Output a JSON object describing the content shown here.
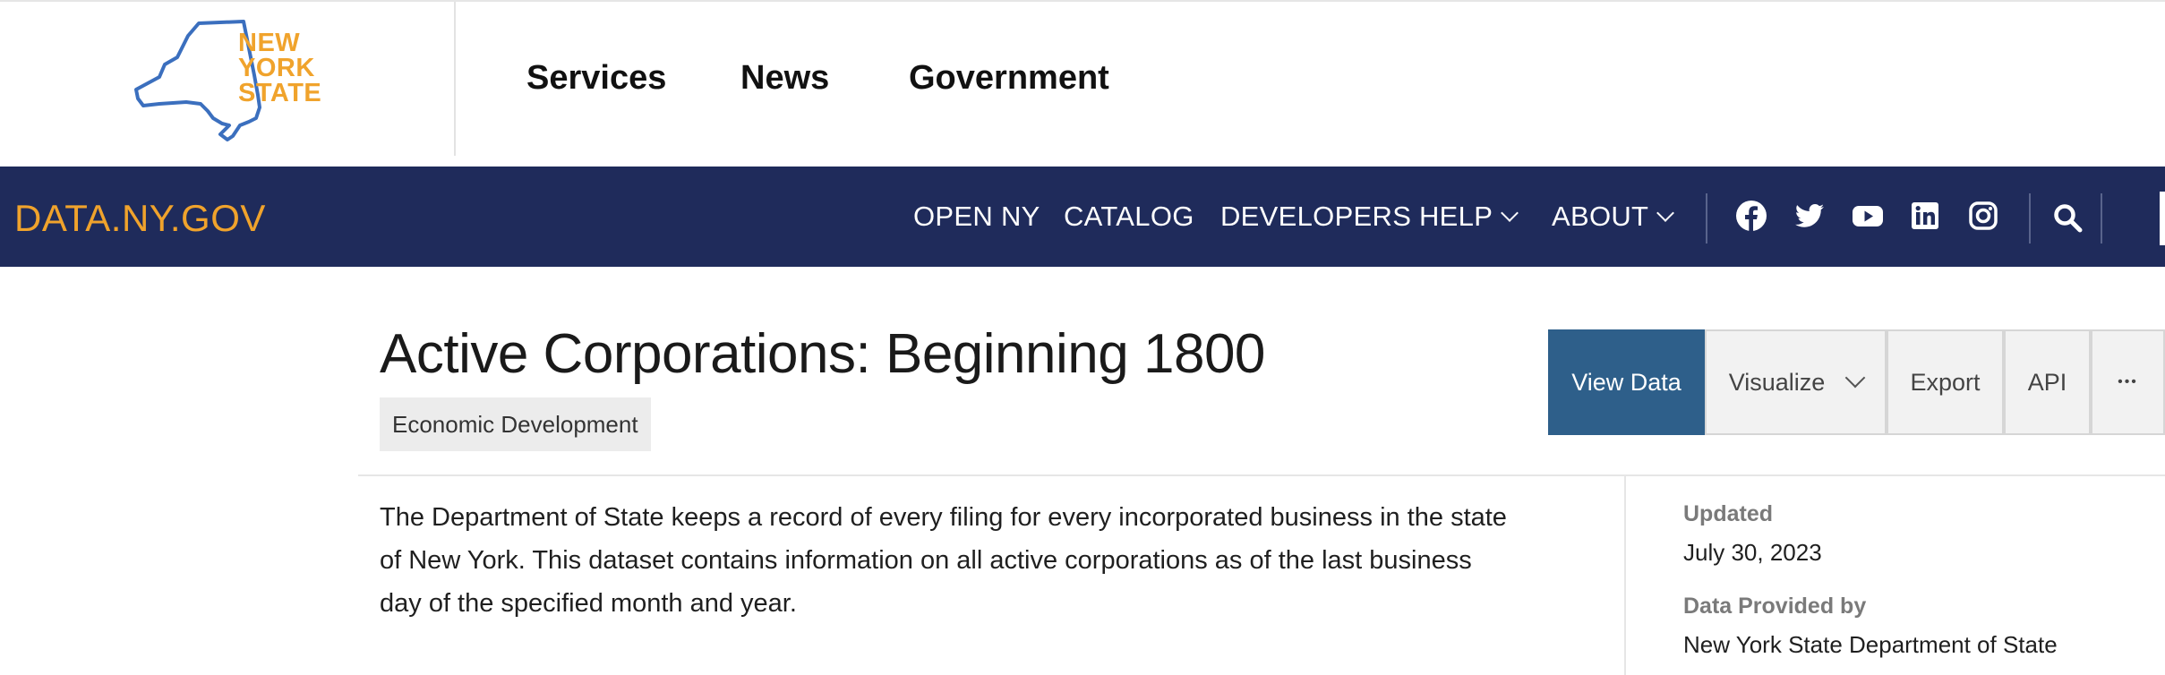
{
  "header": {
    "logo": {
      "lines": [
        "NEW",
        "YORK",
        "STATE"
      ],
      "icon": "new-york-state-outline"
    },
    "nav": [
      "Services",
      "News",
      "Government"
    ]
  },
  "navbar": {
    "brand": "DATA.NY.GOV",
    "links": [
      {
        "label": "OPEN NY",
        "dropdown": false
      },
      {
        "label": "CATALOG",
        "dropdown": false
      },
      {
        "label": "DEVELOPERS",
        "dropdown": false
      },
      {
        "label": "HELP",
        "dropdown": true
      },
      {
        "label": "ABOUT",
        "dropdown": true
      }
    ],
    "social_icons": [
      "facebook-icon",
      "twitter-icon",
      "youtube-icon",
      "linkedin-icon",
      "instagram-icon"
    ],
    "search_icon": "search-icon"
  },
  "dataset": {
    "title": "Active Corporations: Beginning 1800",
    "category": "Economic Development",
    "description": "The Department of State keeps a record of every filing for every incorporated business in the state of New York. This dataset contains information on all active corporations as of the last business day of the specified month and year.",
    "actions": {
      "view_data": "View Data",
      "visualize": "Visualize",
      "export": "Export",
      "api": "API",
      "more": "•••"
    },
    "meta": {
      "updated_label": "Updated",
      "updated_value": "July 30, 2023",
      "provider_label": "Data Provided by",
      "provider_value": "New York State Department of State"
    }
  },
  "colors": {
    "navbar_bg": "#1f2b5b",
    "brand_accent": "#f0a32c",
    "primary_button": "#2e5f8a",
    "logo_outline": "#3b6fbe"
  }
}
